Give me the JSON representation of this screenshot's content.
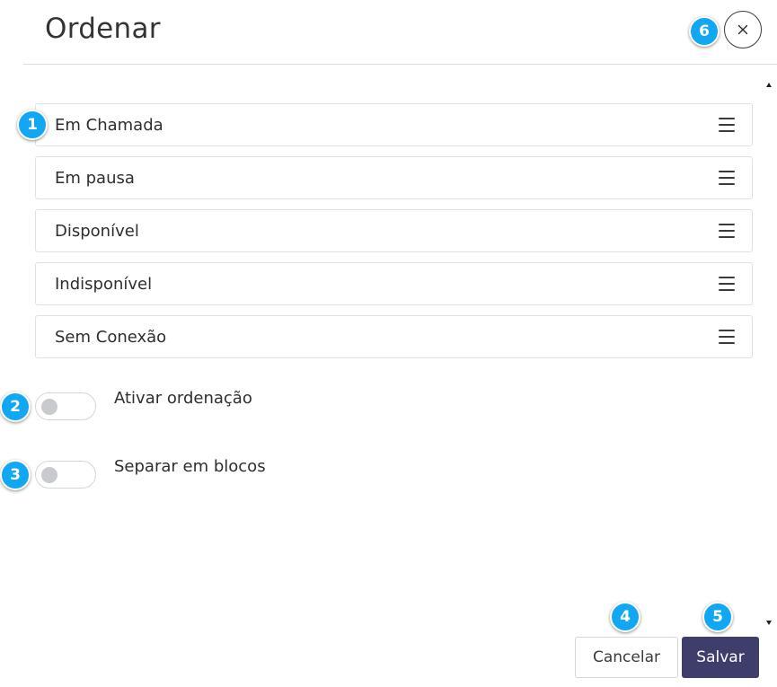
{
  "dialog": {
    "title": "Ordenar",
    "close_icon": "close-icon"
  },
  "list": {
    "items": [
      {
        "label": "Em Chamada"
      },
      {
        "label": "Em pausa"
      },
      {
        "label": "Disponível"
      },
      {
        "label": "Indisponível"
      },
      {
        "label": "Sem Conexão"
      }
    ],
    "handle_icon": "drag-handle-icon"
  },
  "toggles": [
    {
      "label": "Ativar ordenação",
      "checked": false
    },
    {
      "label": "Separar em blocos",
      "checked": false
    }
  ],
  "footer": {
    "cancel_label": "Cancelar",
    "save_label": "Salvar"
  },
  "badges": [
    "1",
    "2",
    "3",
    "4",
    "5",
    "6"
  ],
  "colors": {
    "badge": "#12a7f2",
    "primary": "#3f3d6b",
    "border": "#dfe1e5"
  }
}
